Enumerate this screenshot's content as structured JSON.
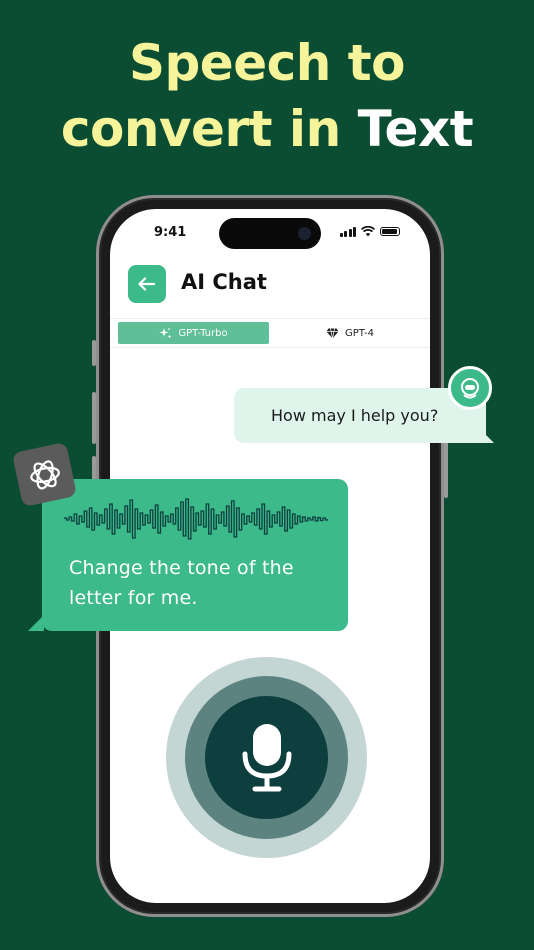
{
  "headline": {
    "line1": "Speech to",
    "line2_part1": "convert in",
    "line2_part2": "Text"
  },
  "status_bar": {
    "time": "9:41"
  },
  "header": {
    "title": "AI Chat"
  },
  "tabs": [
    {
      "label": "GPT-Turbo",
      "active": true
    },
    {
      "label": "GPT-4",
      "active": false
    }
  ],
  "chat": {
    "bot_message": "How may I help you?",
    "user_message": "Change the tone of the letter for me."
  },
  "colors": {
    "background": "#0b4d33",
    "accent": "#3dba8a",
    "headline_yellow": "#f6f49a",
    "bot_bubble": "#dff5ec",
    "mic_dark": "#0d3f3e"
  },
  "icons": {
    "back": "arrow-left-icon",
    "tab1": "sparkles-icon",
    "tab2": "diamond-icon",
    "avatar": "chatbot-avatar-icon",
    "logo": "openai-logo-icon",
    "mic": "microphone-icon",
    "wave": "sound-wave-icon"
  }
}
